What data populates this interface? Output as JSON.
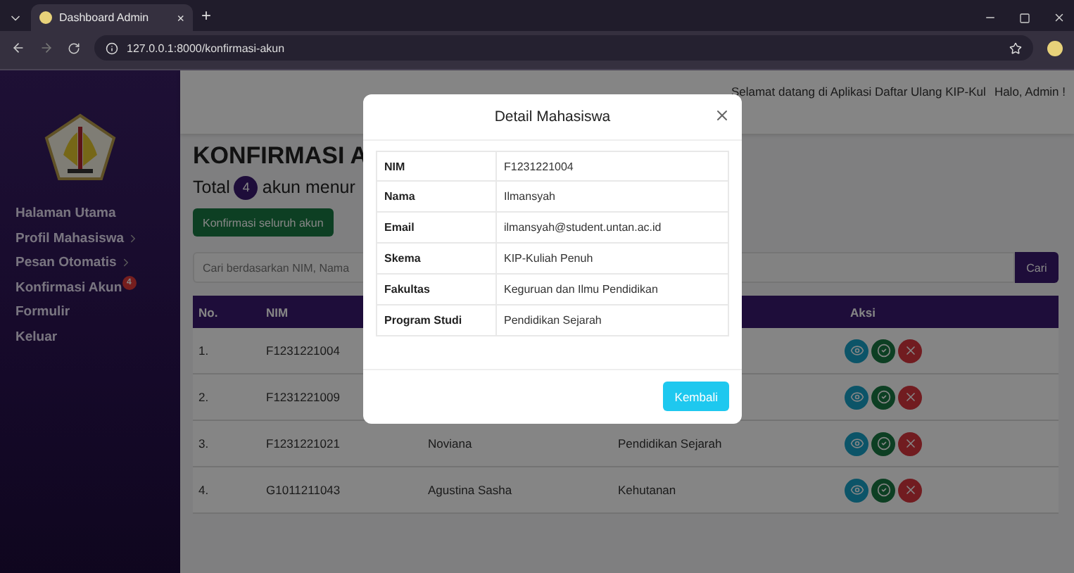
{
  "browser": {
    "tab_title": "Dashboard Admin",
    "tab_close": "×",
    "new_tab": "+",
    "url": "127.0.0.1:8000/konfirmasi-akun"
  },
  "sidebar": {
    "items": [
      {
        "label": "Halaman Utama",
        "expandable": false
      },
      {
        "label": "Profil Mahasiswa",
        "expandable": true
      },
      {
        "label": "Pesan Otomatis",
        "expandable": true
      },
      {
        "label": "Konfirmasi Akun",
        "expandable": false,
        "badge": "4"
      },
      {
        "label": "Formulir",
        "expandable": false
      },
      {
        "label": "Keluar",
        "expandable": false
      }
    ]
  },
  "header": {
    "marquee": "Selamat datang di Aplikasi Daftar Ulang KIP-Kul",
    "greeting": "Halo, Admin !"
  },
  "page": {
    "title": "KONFIRMASI A",
    "total_label": "Total",
    "total_count": "4",
    "total_suffix": "akun menur",
    "confirm_all_button": "Konfirmasi seluruh akun",
    "search": {
      "placeholder": "Cari berdasarkan NIM, Nama",
      "button": "Cari"
    }
  },
  "table": {
    "columns": {
      "no": "No.",
      "nim": "NIM",
      "aksi": "Aksi"
    },
    "rows": [
      {
        "no": "1.",
        "nim": "F1231221004"
      },
      {
        "no": "2.",
        "nim": "F1231221009"
      },
      {
        "no": "3.",
        "nim": "F1231221021",
        "column_3": "Noviana",
        "column_4": "Pendidikan Sejarah"
      },
      {
        "no": "4.",
        "nim": "G1011211043",
        "column_3": "Agustina Sasha",
        "column_4": "Kehutanan"
      }
    ]
  },
  "modal": {
    "title": "Detail Mahasiswa",
    "fields": [
      {
        "label": "NIM",
        "value": "F1231221004"
      },
      {
        "label": "Nama",
        "value": "Ilmansyah"
      },
      {
        "label": "Email",
        "value": "ilmansyah@student.untan.ac.id"
      },
      {
        "label": "Skema",
        "value": "KIP-Kuliah Penuh"
      },
      {
        "label": "Fakultas",
        "value": "Keguruan dan Ilmu Pendidikan"
      },
      {
        "label": "Program Studi",
        "value": "Pendidikan Sejarah"
      }
    ],
    "back_button": "Kembali"
  }
}
